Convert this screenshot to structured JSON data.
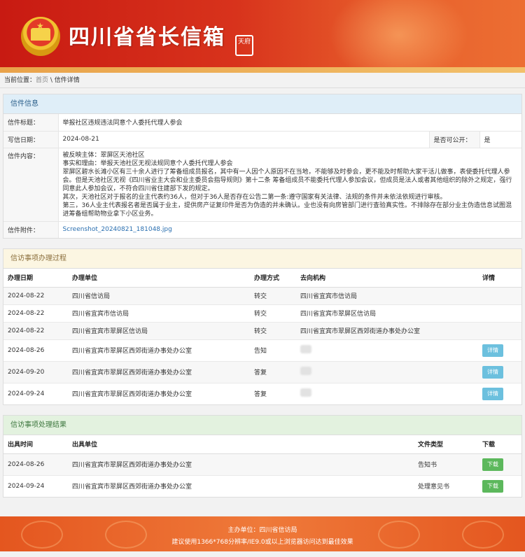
{
  "header": {
    "title": "四川省省长信箱",
    "seal_text": "天府"
  },
  "breadcrumb": {
    "prefix": "当前位置：",
    "home": "首页",
    "separator": " \\ ",
    "current": "信件详情"
  },
  "letter": {
    "section_title": "信件信息",
    "subject_label": "信件标题：",
    "subject": "举报社区违规违法同意个人委托代理人参会",
    "date_label": "写信日期：",
    "date": "2024-08-21",
    "public_label": "是否可公开：",
    "public_value": "是",
    "content_label": "信件内容：",
    "content": [
      "被反映主体：翠屏区天池社区",
      "事实和理由：举报天池社区无视法规同意个人委托代理人参会",
      "翠屏区碧水长滩小区有三十余人进行了筹备组成员报名，其中有一人因个人原因不在当地，不能够及时参会，更不能及时帮助大家干活儿做事，表使委托代理人参会。但是天池社区无视《四川省业主大会和业主委员会指导规则》第十二条 筹备组成员不能委托代理人参加会议，但成员是法人或者其他组织的除外之规定，强行同意此人参加会议，不符合四川省住建部下发的规定。",
      "其次，天池社区对于报名的业主代表约36人，但对于36人是否存在公告二第一条:遵守国家有关法律、法规的条件并未依法依规进行审核。",
      "第三，36人业主代表报名者是否属于业主，提供房产证复印件是否为伪造的并未确认。业也没有向房管部门进行查验真实性。不排除存在部分业主伪造信息试图混进筹备组帮助物业拿下小区业务。"
    ],
    "attachment_label": "信件附件：",
    "attachment": "Screenshot_20240821_181048.jpg"
  },
  "process": {
    "section_title": "信访事项办理过程",
    "columns": [
      "办理日期",
      "办理单位",
      "办理方式",
      "去向机构",
      "详情"
    ],
    "rows": [
      {
        "date": "2024-08-22",
        "unit": "四川省信访局",
        "method": "转交",
        "dest": "四川省宜宾市信访局",
        "detail": ""
      },
      {
        "date": "2024-08-22",
        "unit": "四川省宜宾市信访局",
        "method": "转交",
        "dest": "四川省宜宾市翠屏区信访局",
        "detail": ""
      },
      {
        "date": "2024-08-22",
        "unit": "四川省宜宾市翠屏区信访局",
        "method": "转交",
        "dest": "四川省宜宾市翠屏区西郊街道办事处办公室",
        "detail": ""
      },
      {
        "date": "2024-08-26",
        "unit": "四川省宜宾市翠屏区西郊街道办事处办公室",
        "method": "告知",
        "dest": "",
        "detail": "详情"
      },
      {
        "date": "2024-09-20",
        "unit": "四川省宜宾市翠屏区西郊街道办事处办公室",
        "method": "答复",
        "dest": "",
        "detail": "详情"
      },
      {
        "date": "2024-09-24",
        "unit": "四川省宜宾市翠屏区西郊街道办事处办公室",
        "method": "答复",
        "dest": "",
        "detail": "详情"
      }
    ]
  },
  "results": {
    "section_title": "信访事项处理结果",
    "columns": [
      "出具时间",
      "出具单位",
      "文件类型",
      "下载"
    ],
    "rows": [
      {
        "date": "2024-08-26",
        "unit": "四川省宜宾市翠屏区西郊街道办事处办公室",
        "type": "告知书",
        "download": "下载"
      },
      {
        "date": "2024-09-24",
        "unit": "四川省宜宾市翠屏区西郊街道办事处办公室",
        "type": "处理意见书",
        "download": "下载"
      }
    ]
  },
  "footer": {
    "host": "主办单位：四川省信访局",
    "advice": "建议使用1366*768分辨率/IE9.0或以上浏览器访问达到最佳效果"
  },
  "colors": {
    "header_red": "#c81a12",
    "footer_orange": "#e4561f",
    "detail_btn": "#6cc0de",
    "download_btn": "#5cb85c"
  }
}
